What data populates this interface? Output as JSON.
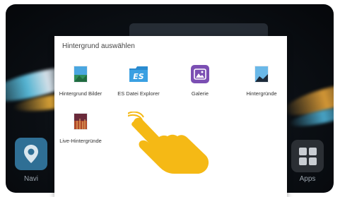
{
  "dialog": {
    "title": "Hintergrund auswählen",
    "options": [
      {
        "label": "Hintergrund Bilder",
        "icon": "gallery-wallpaper-icon"
      },
      {
        "label": "ES Datei Explorer",
        "icon": "es-file-explorer-icon"
      },
      {
        "label": "Galerie",
        "icon": "gallery-icon"
      },
      {
        "label": "Hintergründe",
        "icon": "wallpapers-icon"
      },
      {
        "label": "Live-Hintergründe",
        "icon": "live-wallpapers-icon"
      }
    ]
  },
  "dock": {
    "navi_label": "Navi",
    "apps_label": "Apps"
  },
  "overlay": {
    "icon": "pointing-hand-icon",
    "color": "#f5b915"
  },
  "colors": {
    "dialog_bg": "#ffffff",
    "navi_tile": "#2f6f95",
    "apps_tile": "#2b2f34",
    "gallery_purple": "#7b4fb3",
    "es_blue": "#2a8bd0"
  }
}
